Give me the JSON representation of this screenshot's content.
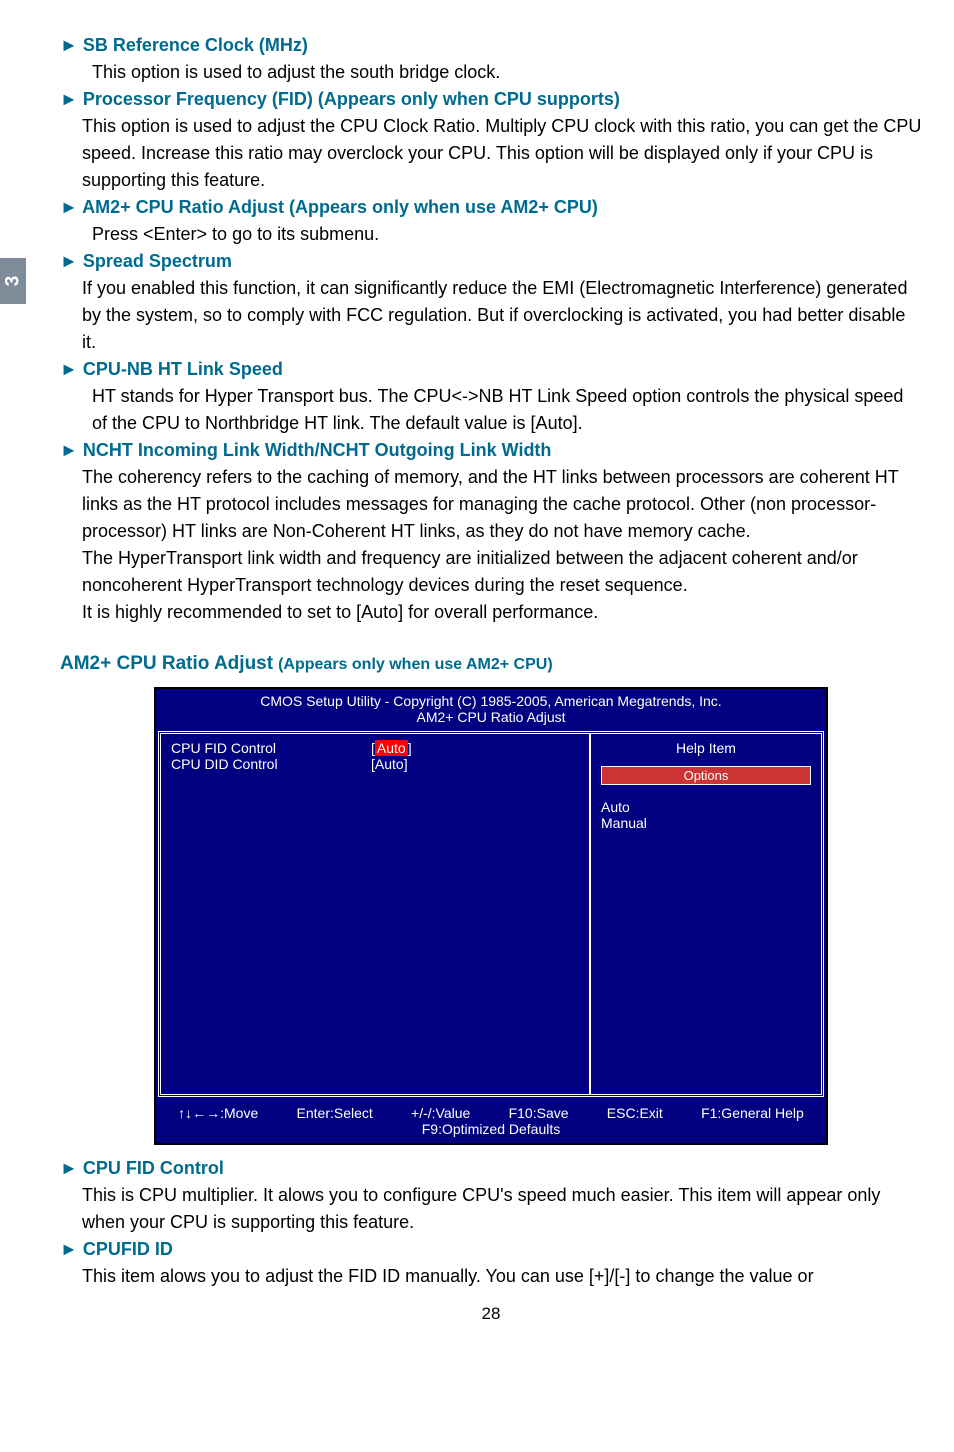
{
  "tab_number": "3",
  "items": [
    {
      "heading": "SB Reference Clock (MHz)",
      "paras": [
        "This option is used to adjust the south bridge clock."
      ],
      "first_para_indent": true
    },
    {
      "heading": "Processor Frequency (FID)  (Appears only when CPU supports)",
      "paras": [
        "This option is used to adjust the CPU Clock Ratio. Multiply CPU clock with this ratio, you can get the CPU speed. Increase this ratio may overclock your CPU. This option will be displayed only if your CPU is supporting this feature."
      ]
    },
    {
      "heading": "AM2+ CPU Ratio Adjust (Appears only when use AM2+ CPU)",
      "paras": [
        "Press <Enter> to go to its submenu."
      ],
      "first_para_indent": true
    },
    {
      "heading": "Spread Spectrum",
      "paras": [
        "If you enabled this function, it can significantly reduce the EMI (Electromagnetic Interference) generated by the system, so to comply with FCC regulation. But if overclocking is activated, you had better disable it."
      ]
    },
    {
      "heading": "CPU-NB HT Link Speed",
      "paras": [
        "HT stands for Hyper Transport bus. The CPU<->NB HT Link Speed option controls the physical speed of the CPU to Northbridge HT link. The default value is [Auto]."
      ],
      "first_para_indent": true
    },
    {
      "heading": "NCHT Incoming Link Width/NCHT Outgoing Link Width",
      "paras": [
        "The coherency refers to the caching of memory, and the HT links between processors are coherent HT links as the HT protocol includes messages for managing the cache protocol. Other (non processor-processor) HT links are Non-Coherent HT links, as they do not have memory cache.",
        "The HyperTransport link width and frequency are initialized between the adjacent coherent and/or noncoherent HyperTransport technology devices during the reset sequence.",
        "It is highly recommended to set to [Auto] for overall performance."
      ]
    }
  ],
  "section2": {
    "title_big": "AM2+ CPU Ratio Adjust",
    "title_small": "(Appears only when use AM2+ CPU)"
  },
  "bios": {
    "title1": "CMOS Setup Utility - Copyright (C) 1985-2005, American Megatrends, Inc.",
    "title2": "AM2+ CPU Ratio Adjust",
    "rows": [
      {
        "label": "CPU FID Control",
        "value": "Auto",
        "hl": true
      },
      {
        "label": "CPU DID Control",
        "value": "[Auto]",
        "hl": false
      }
    ],
    "help_item": "Help Item",
    "options_head": "Options",
    "options": [
      "Auto",
      "Manual"
    ],
    "foot": {
      "move": "↑↓←→:Move",
      "enter": "Enter:Select",
      "value": "+/-/:Value",
      "save": "F10:Save",
      "exit": "ESC:Exit",
      "help": "F1:General Help",
      "defaults": "F9:Optimized Defaults"
    }
  },
  "items2": [
    {
      "heading": "CPU FID Control",
      "paras": [
        "This is CPU multiplier. It alows you to configure CPU's speed much easier. This item will  appear only when your CPU is supporting this feature."
      ]
    },
    {
      "heading": "CPUFID ID",
      "paras": [
        "This item alows you to adjust the FID ID manually. You can use [+]/[-] to change the value or"
      ]
    }
  ],
  "arrow": "►",
  "page_number": "28"
}
